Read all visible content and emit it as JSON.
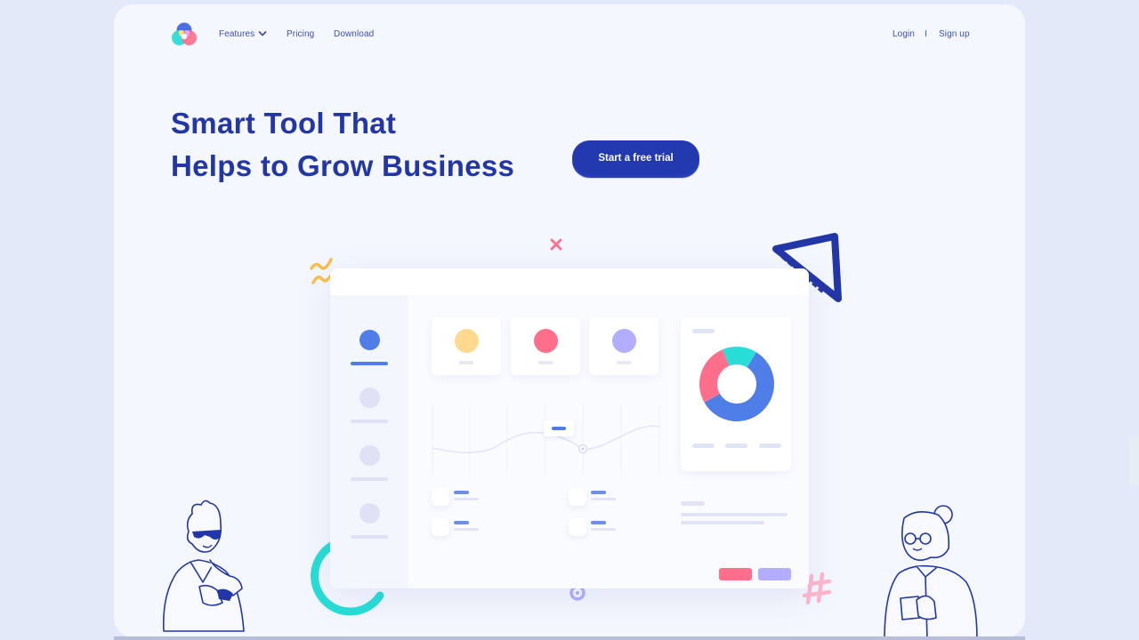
{
  "nav": {
    "logo": "brand-logo",
    "features": "Features",
    "pricing": "Pricing",
    "download": "Download",
    "login": "Login",
    "separator": "I",
    "signup": "Sign up"
  },
  "hero": {
    "title_line1": "Smart Tool That",
    "title_line2": "Helps to Grow Business",
    "cta": "Start a free trial"
  },
  "colors": {
    "brand": "#2336a8",
    "cta": "#2339b0",
    "blue": "#4f7ee8",
    "yellow": "#ffd98e",
    "pink": "#ff6f8c",
    "purple": "#b2adff",
    "teal": "#28ddd6",
    "bg": "#f4f7fe"
  },
  "mockup": {
    "stat_cards": [
      {
        "color": "#ffd98e"
      },
      {
        "color": "#ff6f8c"
      },
      {
        "color": "#b2adff"
      }
    ],
    "donut_segments": [
      {
        "name": "blue",
        "fraction": 0.58,
        "color": "#4f7ee8"
      },
      {
        "name": "pink",
        "fraction": 0.27,
        "color": "#ff6f8c"
      },
      {
        "name": "teal",
        "fraction": 0.15,
        "color": "#28ddd6"
      }
    ]
  }
}
